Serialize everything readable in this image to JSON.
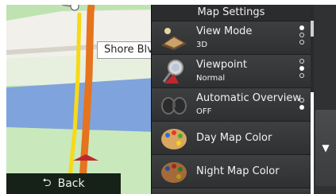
{
  "map": {
    "street_label": "Shore Blvd"
  },
  "back_button": {
    "label": "Back",
    "icon": "back-arrow-icon"
  },
  "panel": {
    "title": "Map Settings",
    "items": [
      {
        "label": "View Mode",
        "value": "3D",
        "icon": "view-mode-icon",
        "options_total": 3,
        "selected_index": 0
      },
      {
        "label": "Viewpoint",
        "value": "Normal",
        "icon": "viewpoint-icon",
        "options_total": 3,
        "selected_index": 1
      },
      {
        "label": "Automatic Overview",
        "value": "OFF",
        "icon": "automatic-overview-icon",
        "options_total": 2,
        "selected_index": 1
      },
      {
        "label": "Day Map Color",
        "icon": "day-map-color-icon"
      },
      {
        "label": "Night Map Color",
        "icon": "night-map-color-icon"
      }
    ]
  },
  "scroll_down": {
    "icon": "triangle-down-icon",
    "glyph": "▼"
  },
  "colors": {
    "panel_bg": "#333537",
    "route": "#f7d917",
    "road": "#e6731d",
    "water": "#7fa3dc",
    "land": "#bfe3b0"
  }
}
